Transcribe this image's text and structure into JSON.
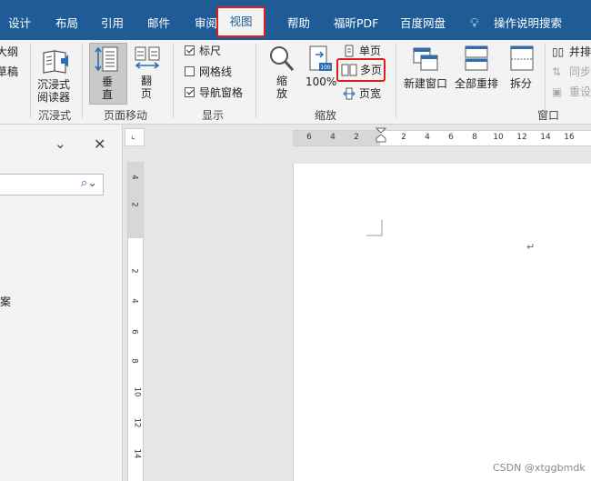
{
  "window": {
    "title_fragment": ""
  },
  "tabs": {
    "design": "设计",
    "layout": "布局",
    "references": "引用",
    "mailings": "邮件",
    "review": "审阅",
    "view": "视图",
    "help": "帮助",
    "foxit_pdf": "福昕PDF",
    "baidu_netdisk": "百度网盘",
    "tell_me": "操作说明搜索"
  },
  "ribbon": {
    "views_partial": {
      "outline": "大纲",
      "draft": "草稿"
    },
    "immersive": {
      "reader_label": "沉浸式\n阅读器",
      "group": "沉浸式"
    },
    "page_movement": {
      "vertical": "垂\n直",
      "side_by_side": "翻\n页",
      "group": "页面移动"
    },
    "show": {
      "ruler": "标尺",
      "ruler_checked": true,
      "gridlines": "网格线",
      "gridlines_checked": false,
      "nav_pane": "导航窗格",
      "nav_pane_checked": true,
      "group": "显示"
    },
    "zoom": {
      "zoom": "缩\n放",
      "hundred": "100%",
      "one_page": "单页",
      "multiple_pages": "多页",
      "page_width": "页宽",
      "group": "缩放"
    },
    "window": {
      "new_window": "新建窗口",
      "arrange_all": "全部重排",
      "split": "拆分",
      "side_by_side": "并排",
      "sync_scroll": "同步",
      "reset": "重设",
      "group": "窗口"
    }
  },
  "nav_pane": {
    "result_fragment": "案"
  },
  "ruler": {
    "h_ticks": [
      "6",
      "4",
      "2",
      "2",
      "4",
      "6",
      "8",
      "10",
      "12",
      "14",
      "16"
    ],
    "v_ticks": [
      "4",
      "2",
      "2",
      "4",
      "6",
      "8",
      "10",
      "12",
      "14"
    ]
  },
  "watermark": "CSDN @xtggbmdk",
  "colors": {
    "tabbar": "#1f5b96",
    "highlight": "#e41b1b",
    "ribbon": "#f3f3f3"
  }
}
